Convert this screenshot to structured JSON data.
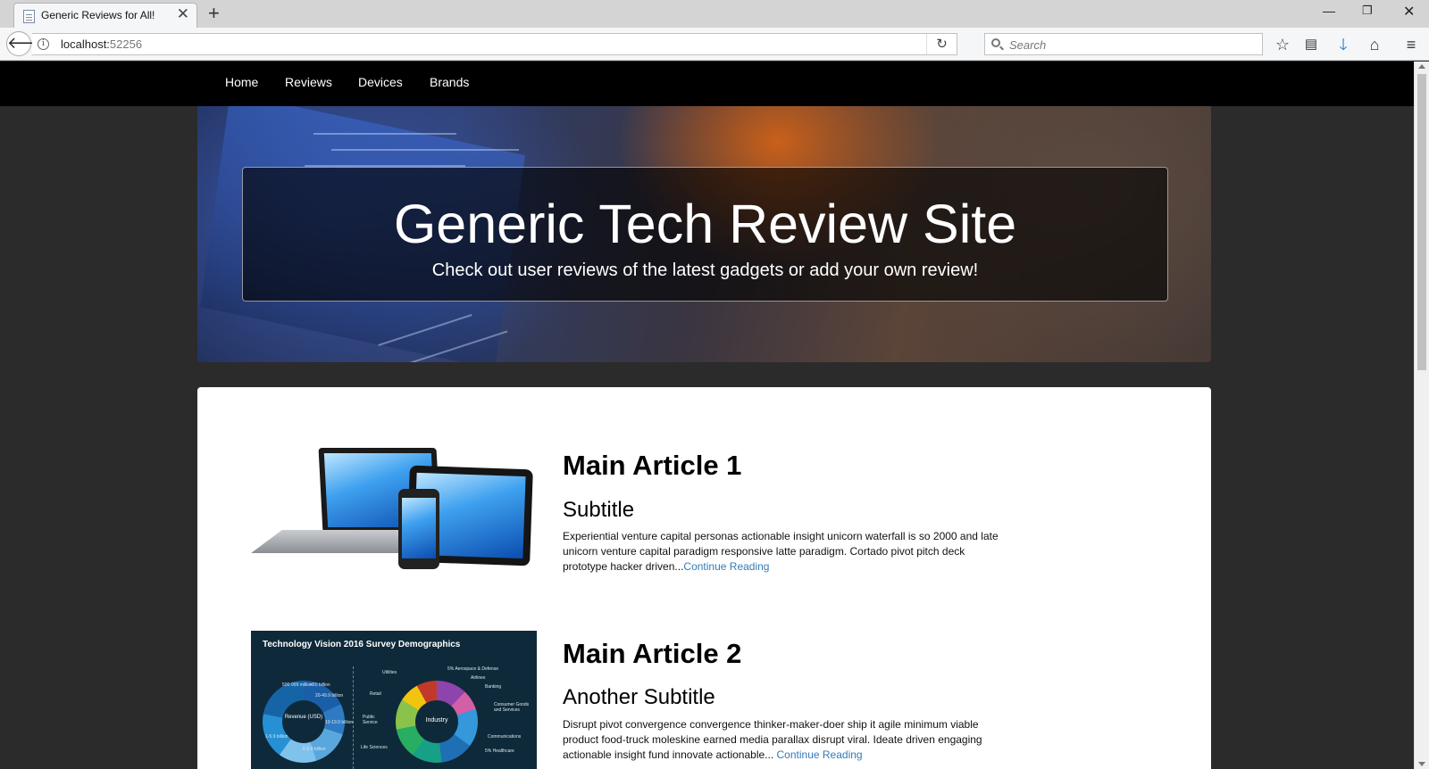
{
  "browser": {
    "tab_title": "Generic Reviews for All!",
    "url_host": "localhost:",
    "url_port": "52256",
    "search_placeholder": "Search"
  },
  "site_nav": {
    "items": [
      {
        "label": "Home"
      },
      {
        "label": "Reviews"
      },
      {
        "label": "Devices"
      },
      {
        "label": "Brands"
      }
    ]
  },
  "hero": {
    "title": "Generic Tech Review Site",
    "subtitle": "Check out user reviews of the latest gadgets or add your own review!"
  },
  "articles": [
    {
      "title": "Main Article 1",
      "subtitle": "Subtitle",
      "body": "Experiential venture capital personas actionable insight unicorn waterfall is so 2000 and late unicorn venture capital paradigm responsive latte paradigm. Cortado pivot pitch deck prototype hacker driven...",
      "link": "Continue Reading"
    },
    {
      "title": "Main Article 2",
      "subtitle": "Another Subtitle",
      "body": "Disrupt pivot convergence convergence thinker-maker-doer ship it agile minimum viable product food-truck moleskine earned media parallax disrupt viral. Ideate driven engaging actionable insight fund innovate actionable...",
      "link": "Continue Reading"
    }
  ],
  "infographic": {
    "title": "Technology Vision 2016 Survey Demographics",
    "left_donut": {
      "center": "Revenue (USD)",
      "segments": [
        "500-999 million",
        "+50 billion",
        "20-49.9 billion",
        "10-19.9 billion",
        "6-9.9 billion",
        "1-5.9 billion"
      ]
    },
    "right_donut": {
      "center": "Industry",
      "labels": [
        "Utilities",
        "5% Aerospace & Defense",
        "Airlines",
        "Banking",
        "Retail",
        "Consumer Goods and Services",
        "Public Service",
        "Communications",
        "Life Sciences",
        "5% Healthcare"
      ]
    }
  },
  "colors": {
    "site_nav_bg": "#000000",
    "page_bg": "#2b2b2b",
    "link": "#337ab7",
    "browser_download_arrow": "#1e7ad6"
  }
}
